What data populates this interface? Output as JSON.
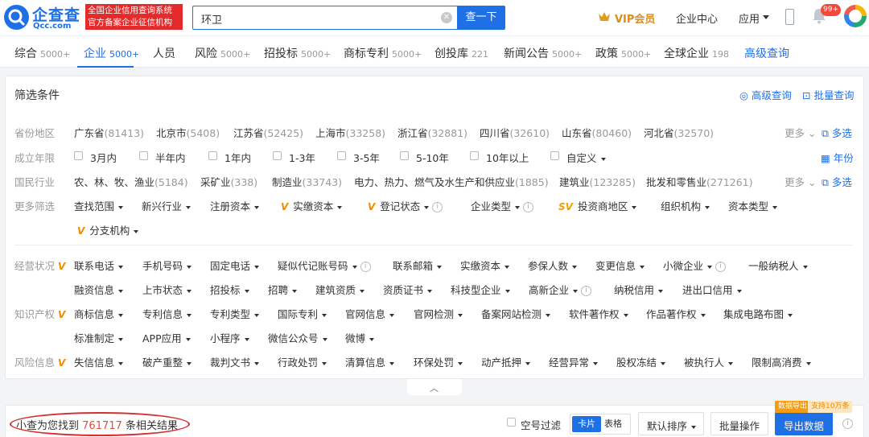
{
  "header": {
    "logo_name": "企查查",
    "logo_domain": "Qcc.com",
    "slogan_line1": "全国企业信用查询系统",
    "slogan_line2": "官方备案企业征信机构",
    "search_value": "环卫",
    "search_button": "查一下",
    "vip": "VIP会员",
    "center": "企业中心",
    "app": "应用",
    "notification_badge": "99+"
  },
  "tabs": [
    {
      "label": "综合",
      "count": "5000+"
    },
    {
      "label": "企业",
      "count": "5000+"
    },
    {
      "label": "人员",
      "count": ""
    },
    {
      "label": "风险",
      "count": "5000+"
    },
    {
      "label": "招投标",
      "count": "5000+"
    },
    {
      "label": "商标专利",
      "count": "5000+"
    },
    {
      "label": "创投库",
      "count": "221"
    },
    {
      "label": "新闻公告",
      "count": "5000+"
    },
    {
      "label": "政策",
      "count": "5000+"
    },
    {
      "label": "全球企业",
      "count": "198"
    },
    {
      "label": "高级查询",
      "count": ""
    }
  ],
  "filter": {
    "title": "筛选条件",
    "advanced": "高级查询",
    "batch": "批量查询",
    "more": "更多",
    "multi": "多选",
    "year": "年份",
    "province": {
      "label": "省份地区",
      "items": [
        {
          "name": "广东省",
          "count": "(81413)"
        },
        {
          "name": "北京市",
          "count": "(5408)"
        },
        {
          "name": "江苏省",
          "count": "(52425)"
        },
        {
          "name": "上海市",
          "count": "(33258)"
        },
        {
          "name": "浙江省",
          "count": "(32881)"
        },
        {
          "name": "四川省",
          "count": "(32610)"
        },
        {
          "name": "山东省",
          "count": "(80460)"
        },
        {
          "name": "河北省",
          "count": "(32570)"
        }
      ]
    },
    "founded": {
      "label": "成立年限",
      "items": [
        "3月内",
        "半年内",
        "1年内",
        "1-3年",
        "3-5年",
        "5-10年",
        "10年以上",
        "自定义"
      ]
    },
    "industry": {
      "label": "国民行业",
      "items": [
        {
          "name": "农、林、牧、渔业",
          "count": "(5184)"
        },
        {
          "name": "采矿业",
          "count": "(338)"
        },
        {
          "name": "制造业",
          "count": "(33743)"
        },
        {
          "name": "电力、热力、燃气及水生产和供应业",
          "count": "(1885)"
        },
        {
          "name": "建筑业",
          "count": "(123285)"
        },
        {
          "name": "批发和零售业",
          "count": "(271261)"
        }
      ]
    },
    "more_filters": {
      "label": "更多筛选",
      "items": [
        "查找范围",
        "新兴行业",
        "注册资本",
        "实缴资本",
        "登记状态",
        "企业类型",
        "投资商地区",
        "组织机构",
        "资本类型",
        "分支机构"
      ]
    },
    "business": {
      "label": "经营状况",
      "row1": [
        "联系电话",
        "手机号码",
        "固定电话",
        "疑似代记账号码",
        "联系邮箱",
        "实缴资本",
        "参保人数",
        "变更信息",
        "小微企业",
        "一般纳税人"
      ],
      "row2": [
        "融资信息",
        "上市状态",
        "招投标",
        "招聘",
        "建筑资质",
        "资质证书",
        "科技型企业",
        "高新企业",
        "纳税信用",
        "进出口信用"
      ]
    },
    "ip": {
      "label": "知识产权",
      "row1": [
        "商标信息",
        "专利信息",
        "专利类型",
        "国际专利",
        "官网信息",
        "官网检测",
        "备案网站检测",
        "软件著作权",
        "作品著作权",
        "集成电路布图"
      ],
      "row2": [
        "标准制定",
        "APP应用",
        "小程序",
        "微信公众号",
        "微博"
      ]
    },
    "risk": {
      "label": "风险信息",
      "items": [
        "失信信息",
        "破产重整",
        "裁判文书",
        "行政处罚",
        "清算信息",
        "环保处罚",
        "动产抵押",
        "经营异常",
        "股权冻结",
        "被执行人",
        "限制高消费"
      ]
    }
  },
  "results": {
    "prefix": "小查为您找到",
    "count": "761717",
    "suffix": "条相关结果",
    "empty_filter": "空号过滤",
    "card": "卡片",
    "table": "表格",
    "sort": "默认排序",
    "batch": "批量操作",
    "export": "导出数据",
    "tag_export": "数据导出",
    "tag_support": "支持10万条"
  },
  "colors": {
    "brand": "#1f6fe5",
    "count_red": "#e34d3c",
    "vip_gold": "#d98d1c"
  }
}
